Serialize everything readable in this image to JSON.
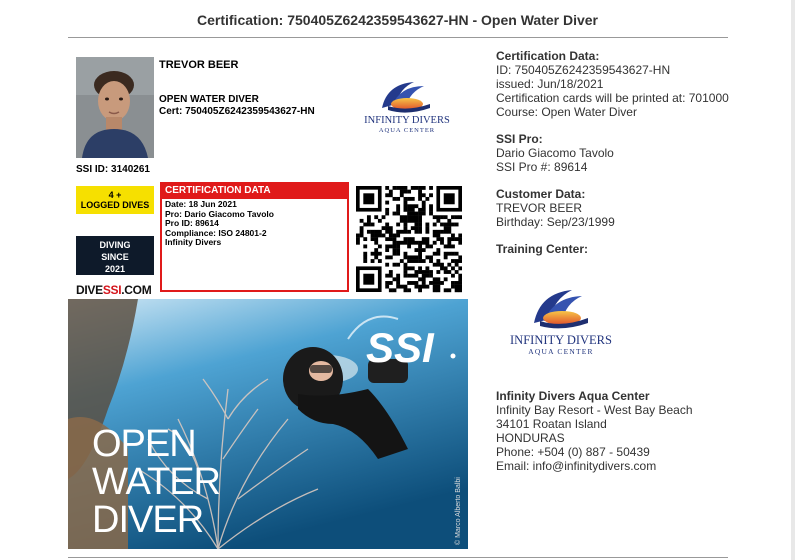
{
  "page": {
    "title": "Certification: 750405Z6242359543627-HN - Open Water Diver"
  },
  "card": {
    "holder_name": "TREVOR BEER",
    "level": "OPEN WATER DIVER",
    "cert_line": "Cert: 750405Z6242359543627-HN",
    "ssi_id": "SSI ID: 3140261",
    "badge_logged_top": "4 +",
    "badge_logged_bottom": "LOGGED DIVES",
    "badge_since_1": "DIVING",
    "badge_since_2": "SINCE",
    "badge_since_3": "2021",
    "divessi_a": "DIVE",
    "divessi_b": "SSI",
    "divessi_c": ".COM",
    "cert_box": {
      "header": "CERTIFICATION DATA",
      "date": "Date: 18 Jun 2021",
      "pro": "Pro: Dario Giacomo Tavolo",
      "pro_id": "Pro ID: 89614",
      "compliance": "Compliance: ISO 24801-2",
      "center": "Infinity Divers"
    },
    "logo_text_1": "INFINITY DIVERS",
    "logo_text_2": "AQUA CENTER",
    "banner_line1": "OPEN",
    "banner_line2": "WATER",
    "banner_line3": "DIVER",
    "banner_brand": "SSI",
    "banner_credit": "© Marco Alberto Balbi"
  },
  "certification_data": {
    "label": "Certification Data:",
    "id": "ID: 750405Z6242359543627-HN",
    "issued": "issued: Jun/18/2021",
    "printed": "Certification cards will be printed at: 701000",
    "course": "Course: Open Water Diver"
  },
  "ssi_pro": {
    "label": "SSI Pro:",
    "name": "Dario Giacomo Tavolo",
    "number": "SSI Pro #: 89614"
  },
  "customer": {
    "label": "Customer Data:",
    "name": "TREVOR BEER",
    "birthday": "Birthday: Sep/23/1999"
  },
  "training_center": {
    "label": "Training Center:",
    "logo_text_1": "INFINITY DIVERS",
    "logo_text_2": "AQUA CENTER",
    "name": "Infinity Divers Aqua Center",
    "address1": "Infinity Bay Resort - West Bay Beach",
    "address2": "34101 Roatan Island",
    "country": "HONDURAS",
    "phone": "Phone: +504 (0) 887 - 50439",
    "email": "Email: info@infinitydivers.com"
  },
  "colors": {
    "accent_red": "#e01a1a",
    "badge_yellow": "#f6e000",
    "badge_navy": "#0e1a2a",
    "text": "#333333"
  },
  "icons": [
    "qr-code-icon",
    "infinity-divers-logo",
    "ssi-logo"
  ]
}
